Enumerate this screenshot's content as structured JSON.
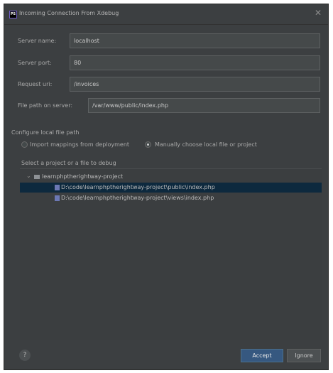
{
  "window": {
    "title": "Incoming Connection From Xdebug",
    "app_icon_text": "PS"
  },
  "form": {
    "server_name": {
      "label": "Server name:",
      "value": "localhost"
    },
    "server_port": {
      "label": "Server port:",
      "value": "80"
    },
    "request_uri": {
      "label": "Request uri:",
      "value": "/invoices"
    },
    "file_path_on_server": {
      "label": "File path on server:",
      "value": "/var/www/public/index.php"
    }
  },
  "local_path": {
    "section_label": "Configure local file path",
    "options": [
      {
        "label": "Import mappings from deployment",
        "selected": false
      },
      {
        "label": "Manually choose local file or project",
        "selected": true
      }
    ]
  },
  "tree": {
    "label": "Select a project or a file to debug",
    "project": "learnphptherightway-project",
    "files": [
      {
        "path": "D:\\code\\learnphptherightway-project\\public\\index.php",
        "selected": true
      },
      {
        "path": "D:\\code\\learnphptherightway-project\\views\\index.php",
        "selected": false
      }
    ]
  },
  "footer": {
    "help_label": "?",
    "accept_label": "Accept",
    "ignore_label": "Ignore"
  },
  "colors": {
    "background": "#3c3f41",
    "selection": "#0d293e",
    "primary_button": "#365880"
  }
}
